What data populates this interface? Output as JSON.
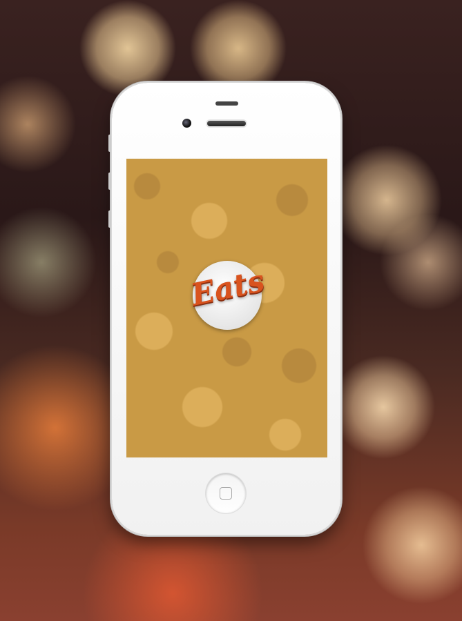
{
  "app": {
    "name": "Eats",
    "accent_color": "#d9531e",
    "background_color": "#c99a45"
  },
  "device": {
    "type": "iPhone 4",
    "color": "white"
  }
}
